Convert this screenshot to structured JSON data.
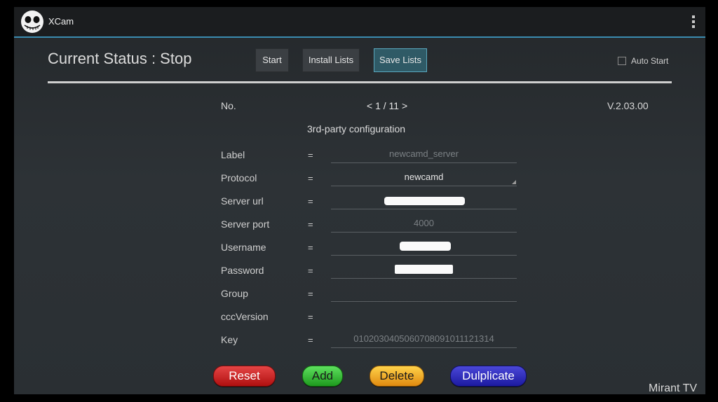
{
  "app": {
    "title": "XCam"
  },
  "header": {
    "status": "Current Status : Stop",
    "buttons": {
      "start": "Start",
      "install": "Install Lists",
      "save": "Save Lists"
    },
    "auto_start": "Auto Start"
  },
  "nav": {
    "no_label": "No.",
    "pager": "< 1 / 11 >",
    "version": "V.2.03.00"
  },
  "section_title": "3rd-party configuration",
  "separator": "=",
  "fields": {
    "label": {
      "label": "Label",
      "placeholder": "newcamd_server"
    },
    "protocol": {
      "label": "Protocol",
      "value": "newcamd"
    },
    "server_url": {
      "label": "Server url"
    },
    "server_port": {
      "label": "Server port",
      "placeholder": "4000"
    },
    "username": {
      "label": "Username"
    },
    "password": {
      "label": "Password"
    },
    "group": {
      "label": "Group",
      "value": ""
    },
    "ccc_version": {
      "label": "cccVersion"
    },
    "key": {
      "label": "Key",
      "placeholder": "0102030405060708091011121314"
    }
  },
  "actions": {
    "reset": "Reset",
    "add": "Add",
    "delete": "Delete",
    "duplicate": "Dulplicate"
  },
  "watermark": "Mirant TV",
  "colors": {
    "accent": "#3a8bb0",
    "reset": "#d02020",
    "add": "#33cc33",
    "delete": "#f0a020",
    "duplicate": "#2a28c0"
  }
}
